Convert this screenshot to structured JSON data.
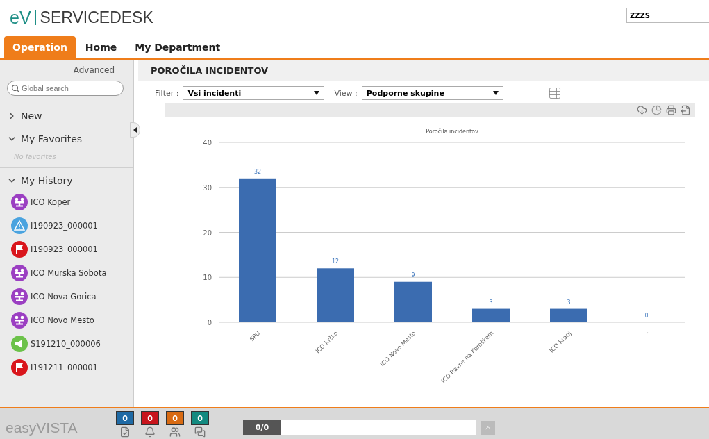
{
  "header": {
    "logo_mark": "eV",
    "logo_name": "SERVICEDESK",
    "search": {
      "value": "ZZZS"
    }
  },
  "tabs": [
    {
      "label": "Operation",
      "selected": true
    },
    {
      "label": "Home",
      "selected": false
    },
    {
      "label": "My Department",
      "selected": false
    }
  ],
  "sidebar": {
    "advanced_link": "Advanced",
    "search": {
      "placeholder": "Global search"
    },
    "sections": [
      {
        "title": "New",
        "expanded": false
      },
      {
        "title": "My Favorites",
        "expanded": true,
        "empty_text": "No favorites"
      },
      {
        "title": "My History",
        "expanded": true,
        "items": [
          {
            "kind": "group",
            "label": "ICO Koper"
          },
          {
            "kind": "warning",
            "label": "I190923_000001"
          },
          {
            "kind": "flag",
            "label": "I190923_000001"
          },
          {
            "kind": "group",
            "label": "ICO Murska Sobota"
          },
          {
            "kind": "group",
            "label": "ICO Nova Gorica"
          },
          {
            "kind": "group",
            "label": "ICO Novo Mesto"
          },
          {
            "kind": "request",
            "label": "S191210_000006"
          },
          {
            "kind": "flag",
            "label": "I191211_000001"
          }
        ]
      }
    ]
  },
  "main": {
    "title": "POROČILA INCIDENTOV",
    "filters": [
      {
        "label": "Filter :",
        "value": "Vsi incidenti"
      },
      {
        "label": "View :",
        "value": "Podporne skupine"
      }
    ],
    "chart_data": {
      "type": "bar",
      "title": "Poročila incidentov",
      "categories": [
        "SPU",
        "ICO Krško",
        "ICO Novo Mesto",
        "ICO Ravne na Koroškem",
        "ICO Kranj",
        "-"
      ],
      "series": [
        {
          "color": "#3b6cb0",
          "values": [
            32,
            12,
            9,
            3,
            3,
            0
          ]
        }
      ],
      "grid": true,
      "ylim": [
        0,
        40
      ],
      "yticks": [
        0,
        10,
        20,
        30,
        40
      ],
      "data_labels": true
    }
  },
  "footer": {
    "logo": "easyVISTA",
    "counters": [
      {
        "value": "0",
        "color": "#1f6aa5",
        "kind": "task"
      },
      {
        "value": "0",
        "color": "#c8141c",
        "kind": "alert"
      },
      {
        "value": "0",
        "color": "#d86a12",
        "kind": "team"
      },
      {
        "value": "0",
        "color": "#138a80",
        "kind": "chat"
      }
    ],
    "pager": "0/0"
  }
}
